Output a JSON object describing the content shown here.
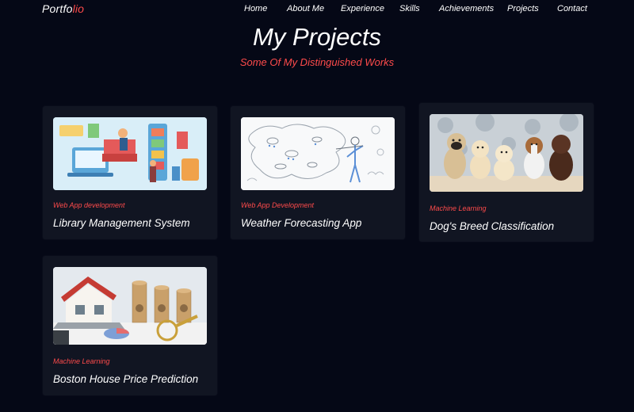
{
  "nav": {
    "brand_a": "Portfo",
    "brand_b": "lio",
    "items": [
      "Home",
      "About Me",
      "Experience",
      "Skills",
      "Achievements",
      "Projects",
      "Contact"
    ]
  },
  "header": {
    "title": "My Projects",
    "subtitle": "Some Of My Distinguished Works"
  },
  "projects": [
    {
      "category": "Web App development",
      "name": "Library Management System",
      "image": "library-illustration-image"
    },
    {
      "category": "Web App Development",
      "name": "Weather Forecasting App",
      "image": "weather-map-illustration-image"
    },
    {
      "category": "Machine Learning",
      "name": "Dog's Breed Classification",
      "image": "dog-puppies-photo-image"
    },
    {
      "category": "Machine Learning",
      "name": "Boston House Price Prediction",
      "image": "house-coins-photo-image"
    }
  ],
  "colors": {
    "background": "#050816",
    "card": "#111522",
    "accent": "#ff4b4b",
    "text": "#ffffff"
  }
}
